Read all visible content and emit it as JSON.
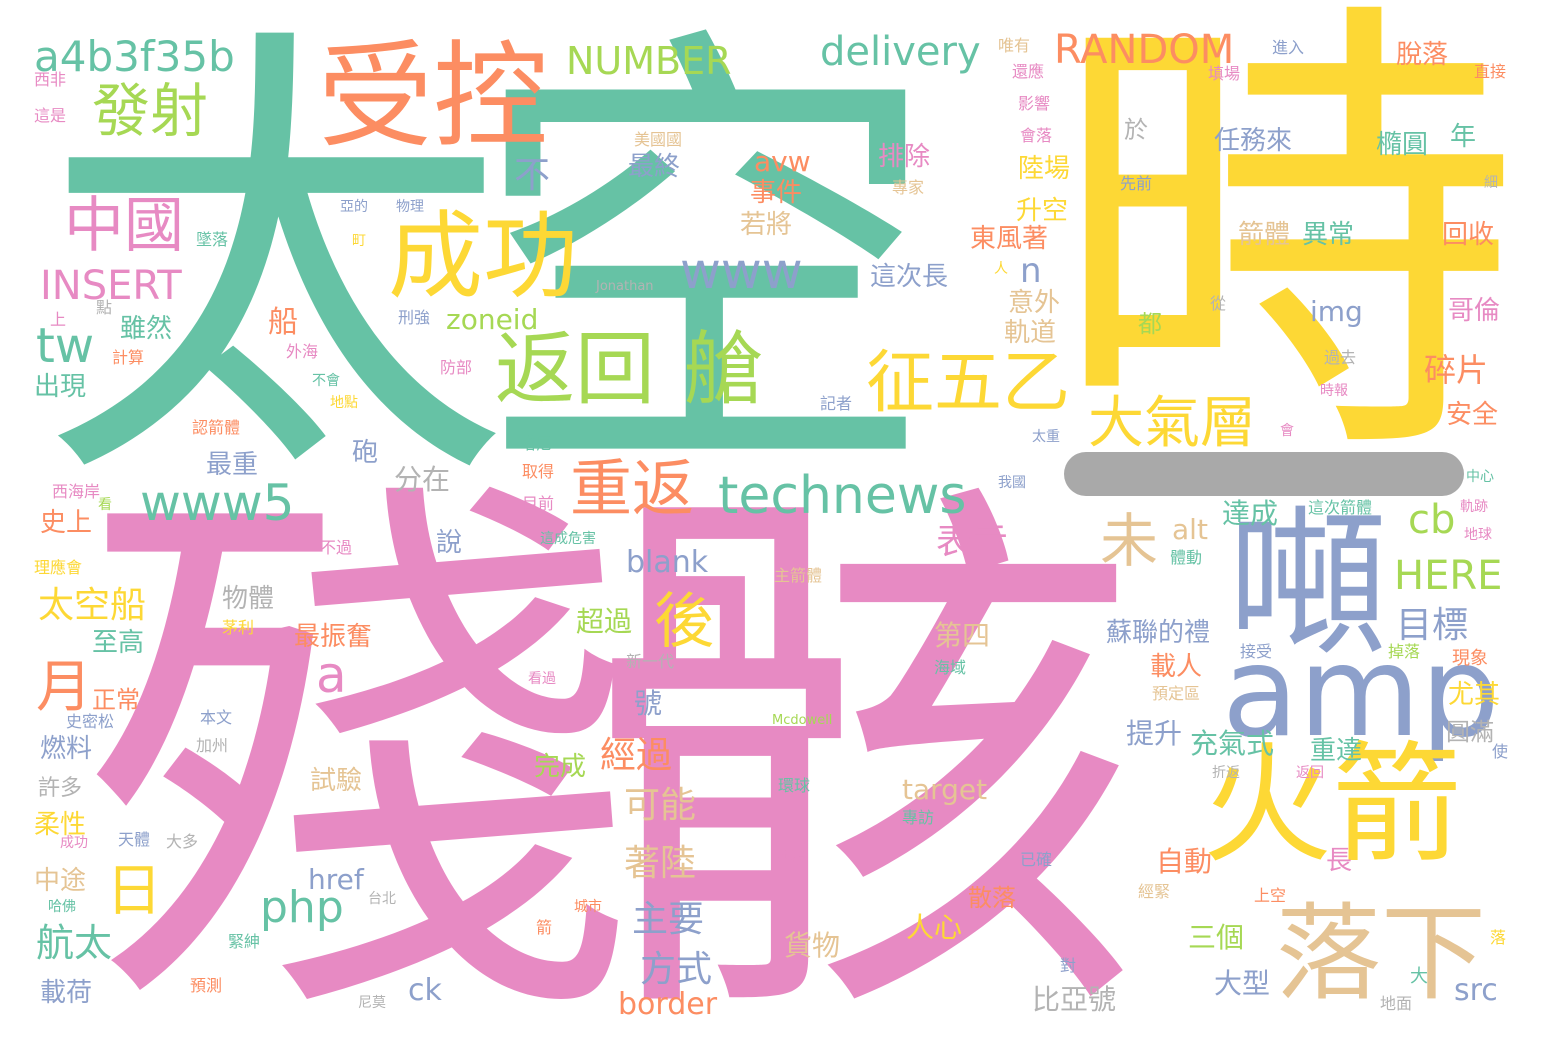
{
  "colors": {
    "green": "#66c2a5",
    "yellow": "#fdd835",
    "orange": "#fc8d62",
    "pink": "#e78ac3",
    "blue": "#8da0cb",
    "lime": "#a6d854",
    "tan": "#e5c494",
    "gray": "#b3b3b3"
  },
  "words": [
    {
      "text": "太空",
      "color": "#66c2a5"
    },
    {
      "text": "時",
      "color": "#fdd835"
    },
    {
      "text": "殘骸",
      "color": "#e78ac3"
    },
    {
      "text": "受控",
      "color": "#fc8d62"
    },
    {
      "text": "成功",
      "color": "#fdd835"
    },
    {
      "text": "返回",
      "color": "#a6d854"
    },
    {
      "text": "艙",
      "color": "#a6d854"
    },
    {
      "text": "征五乙",
      "color": "#fdd835"
    },
    {
      "text": "大氣層",
      "color": "#fdd835"
    },
    {
      "text": "噸",
      "color": "#8da0cb"
    },
    {
      "text": "amp",
      "color": "#8da0cb"
    },
    {
      "text": "火箭",
      "color": "#fdd835"
    },
    {
      "text": "落下",
      "color": "#e5c494"
    },
    {
      "text": "technews",
      "color": "#66c2a5"
    },
    {
      "text": "www5",
      "color": "#66c2a5"
    },
    {
      "text": "www",
      "color": "#8da0cb"
    },
    {
      "text": "重返",
      "color": "#fc8d62"
    },
    {
      "text": "發射",
      "color": "#a6d854"
    },
    {
      "text": "中國",
      "color": "#e78ac3"
    },
    {
      "text": "a4b3f35b",
      "color": "#66c2a5"
    },
    {
      "text": "NUMBER",
      "color": "#a6d854"
    },
    {
      "text": "delivery",
      "color": "#66c2a5"
    },
    {
      "text": "RANDOM",
      "color": "#fc8d62"
    },
    {
      "text": "INSERT",
      "color": "#e78ac3"
    },
    {
      "text": "tw",
      "color": "#66c2a5"
    },
    {
      "text": "後",
      "color": "#fdd835"
    },
    {
      "text": "未",
      "color": "#e5c494"
    },
    {
      "text": "月",
      "color": "#fc8d62"
    },
    {
      "text": "日",
      "color": "#fdd835"
    },
    {
      "text": "a",
      "color": "#e78ac3"
    },
    {
      "text": "php",
      "color": "#66c2a5"
    },
    {
      "text": "cb",
      "color": "#a6d854"
    },
    {
      "text": "HERE",
      "color": "#a6d854"
    },
    {
      "text": "太空船",
      "color": "#fdd835"
    },
    {
      "text": "航太",
      "color": "#66c2a5"
    },
    {
      "text": "主要",
      "color": "#8da0cb"
    },
    {
      "text": "方式",
      "color": "#8da0cb"
    },
    {
      "text": "著陸",
      "color": "#e5c494"
    },
    {
      "text": "可能",
      "color": "#e5c494"
    },
    {
      "text": "經過",
      "color": "#fc8d62"
    },
    {
      "text": "表示",
      "color": "#e78ac3"
    },
    {
      "text": "目標",
      "color": "#8da0cb"
    },
    {
      "text": "碎片",
      "color": "#fc8d62"
    },
    {
      "text": "n",
      "color": "#8da0cb"
    },
    {
      "text": "zoneid",
      "color": "#a6d854"
    },
    {
      "text": "img",
      "color": "#8da0cb"
    },
    {
      "text": "blank",
      "color": "#8da0cb"
    },
    {
      "text": "src",
      "color": "#8da0cb"
    },
    {
      "text": "border",
      "color": "#fc8d62"
    },
    {
      "text": "ck",
      "color": "#8da0cb"
    },
    {
      "text": "href",
      "color": "#8da0cb"
    },
    {
      "text": "alt",
      "color": "#e5c494"
    },
    {
      "text": "target",
      "color": "#e5c494"
    },
    {
      "text": "avw",
      "color": "#fc8d62"
    },
    {
      "text": "不",
      "color": "#8da0cb"
    },
    {
      "text": "船",
      "color": "#fc8d62"
    },
    {
      "text": "雖然",
      "color": "#66c2a5"
    },
    {
      "text": "出現",
      "color": "#66c2a5"
    },
    {
      "text": "最重",
      "color": "#8da0cb"
    },
    {
      "text": "史上",
      "color": "#fc8d62"
    },
    {
      "text": "砲",
      "color": "#8da0cb"
    },
    {
      "text": "分在",
      "color": "#b3b3b3"
    },
    {
      "text": "說",
      "color": "#8da0cb"
    },
    {
      "text": "物體",
      "color": "#b3b3b3"
    },
    {
      "text": "至高",
      "color": "#66c2a5"
    },
    {
      "text": "最振奮",
      "color": "#fc8d62"
    },
    {
      "text": "號",
      "color": "#8da0cb"
    },
    {
      "text": "正常",
      "color": "#fc8d62"
    },
    {
      "text": "燃料",
      "color": "#8da0cb"
    },
    {
      "text": "完成",
      "color": "#a6d854"
    },
    {
      "text": "試驗",
      "color": "#e5c494"
    },
    {
      "text": "許多",
      "color": "#b3b3b3"
    },
    {
      "text": "柔性",
      "color": "#fdd835"
    },
    {
      "text": "中途",
      "color": "#e5c494"
    },
    {
      "text": "載荷",
      "color": "#8da0cb"
    },
    {
      "text": "貨物",
      "color": "#e5c494"
    },
    {
      "text": "超過",
      "color": "#a6d854"
    },
    {
      "text": "人心",
      "color": "#fdd835"
    },
    {
      "text": "比亞號",
      "color": "#b3b3b3"
    },
    {
      "text": "散落",
      "color": "#fc8d62"
    },
    {
      "text": "三個",
      "color": "#a6d854"
    },
    {
      "text": "大型",
      "color": "#8da0cb"
    },
    {
      "text": "自動",
      "color": "#fc8d62"
    },
    {
      "text": "長",
      "color": "#e78ac3"
    },
    {
      "text": "第四",
      "color": "#e5c494"
    },
    {
      "text": "提升",
      "color": "#8da0cb"
    },
    {
      "text": "充氣式",
      "color": "#66c2a5"
    },
    {
      "text": "重達",
      "color": "#66c2a5"
    },
    {
      "text": "載人",
      "color": "#fc8d62"
    },
    {
      "text": "蘇聯的禮",
      "color": "#8da0cb"
    },
    {
      "text": "達成",
      "color": "#66c2a5"
    },
    {
      "text": "尤其",
      "color": "#fdd835"
    },
    {
      "text": "圓滿",
      "color": "#b3b3b3"
    },
    {
      "text": "安全",
      "color": "#fc8d62"
    },
    {
      "text": "哥倫",
      "color": "#e78ac3"
    },
    {
      "text": "回收",
      "color": "#fc8d62"
    },
    {
      "text": "箭體",
      "color": "#e5c494"
    },
    {
      "text": "異常",
      "color": "#66c2a5"
    },
    {
      "text": "任務來",
      "color": "#8da0cb"
    },
    {
      "text": "橢圓",
      "color": "#66c2a5"
    },
    {
      "text": "年",
      "color": "#66c2a5"
    },
    {
      "text": "脫落",
      "color": "#fc8d62"
    },
    {
      "text": "最終",
      "color": "#8da0cb"
    },
    {
      "text": "排除",
      "color": "#e78ac3"
    },
    {
      "text": "事件",
      "color": "#fc8d62"
    },
    {
      "text": "若將",
      "color": "#e5c494"
    },
    {
      "text": "陸場",
      "color": "#fdd835"
    },
    {
      "text": "升空",
      "color": "#fdd835"
    },
    {
      "text": "東風著",
      "color": "#fc8d62"
    },
    {
      "text": "這次長",
      "color": "#8da0cb"
    },
    {
      "text": "意外",
      "color": "#e5c494"
    },
    {
      "text": "軌道",
      "color": "#e5c494"
    },
    {
      "text": "都",
      "color": "#a6d854"
    },
    {
      "text": "於",
      "color": "#b3b3b3"
    },
    {
      "text": "西非",
      "color": "#e78ac3"
    },
    {
      "text": "這是",
      "color": "#e78ac3"
    },
    {
      "text": "唯有",
      "color": "#e5c494"
    },
    {
      "text": "還應",
      "color": "#e78ac3"
    },
    {
      "text": "影響",
      "color": "#e78ac3"
    },
    {
      "text": "會落",
      "color": "#e78ac3"
    },
    {
      "text": "美國國",
      "color": "#e5c494"
    },
    {
      "text": "專家",
      "color": "#e5c494"
    },
    {
      "text": "墜落",
      "color": "#66c2a5"
    },
    {
      "text": "亞的",
      "color": "#8da0cb"
    },
    {
      "text": "物理",
      "color": "#8da0cb"
    },
    {
      "text": "町",
      "color": "#fdd835"
    },
    {
      "text": "Jonathan",
      "color": "#b3b3b3"
    },
    {
      "text": "刑強",
      "color": "#8da0cb"
    },
    {
      "text": "外海",
      "color": "#e78ac3"
    },
    {
      "text": "不會",
      "color": "#66c2a5"
    },
    {
      "text": "地點",
      "color": "#fdd835"
    },
    {
      "text": "防部",
      "color": "#e78ac3"
    },
    {
      "text": "記者",
      "color": "#8da0cb"
    },
    {
      "text": "認箭體",
      "color": "#fc8d62"
    },
    {
      "text": "塔尼",
      "color": "#66c2a5"
    },
    {
      "text": "取得",
      "color": "#fc8d62"
    },
    {
      "text": "目前",
      "color": "#e78ac3"
    },
    {
      "text": "西海岸",
      "color": "#e78ac3"
    },
    {
      "text": "理應會",
      "color": "#fdd835"
    },
    {
      "text": "不過",
      "color": "#e78ac3"
    },
    {
      "text": "這成危害",
      "color": "#66c2a5"
    },
    {
      "text": "主箭體",
      "color": "#e5c494"
    },
    {
      "text": "茅利",
      "color": "#fdd835"
    },
    {
      "text": "新一代",
      "color": "#b3b3b3"
    },
    {
      "text": "看過",
      "color": "#e78ac3"
    },
    {
      "text": "Mcdowell",
      "color": "#a6d854"
    },
    {
      "text": "本文",
      "color": "#8da0cb"
    },
    {
      "text": "加州",
      "color": "#b3b3b3"
    },
    {
      "text": "史密松",
      "color": "#8da0cb"
    },
    {
      "text": "環球",
      "color": "#66c2a5"
    },
    {
      "text": "天體",
      "color": "#8da0cb"
    },
    {
      "text": "大多",
      "color": "#b3b3b3"
    },
    {
      "text": "成功",
      "color": "#e78ac3"
    },
    {
      "text": "哈佛",
      "color": "#66c2a5"
    },
    {
      "text": "台北",
      "color": "#b3b3b3"
    },
    {
      "text": "焚毀",
      "color": "#e78ac3"
    },
    {
      "text": "城市",
      "color": "#fc8d62"
    },
    {
      "text": "緊紳",
      "color": "#66c2a5"
    },
    {
      "text": "預測",
      "color": "#fc8d62"
    },
    {
      "text": "尼莫",
      "color": "#b3b3b3"
    },
    {
      "text": "對",
      "color": "#8da0cb"
    },
    {
      "text": "箭",
      "color": "#fc8d62"
    },
    {
      "text": "已確",
      "color": "#8da0cb"
    },
    {
      "text": "經緊",
      "color": "#e5c494"
    },
    {
      "text": "上空",
      "color": "#fc8d62"
    },
    {
      "text": "地面",
      "color": "#b3b3b3"
    },
    {
      "text": "海域",
      "color": "#66c2a5"
    },
    {
      "text": "專訪",
      "color": "#66c2a5"
    },
    {
      "text": "預定區",
      "color": "#e5c494"
    },
    {
      "text": "體動",
      "color": "#66c2a5"
    },
    {
      "text": "接受",
      "color": "#8da0cb"
    },
    {
      "text": "掉落",
      "color": "#a6d854"
    },
    {
      "text": "現象",
      "color": "#fc8d62"
    },
    {
      "text": "使",
      "color": "#8da0cb"
    },
    {
      "text": "折返",
      "color": "#b3b3b3"
    },
    {
      "text": "返回",
      "color": "#e78ac3"
    },
    {
      "text": "這次箭體",
      "color": "#66c2a5"
    },
    {
      "text": "軌跡",
      "color": "#e78ac3"
    },
    {
      "text": "地球",
      "color": "#e78ac3"
    },
    {
      "text": "中心",
      "color": "#66c2a5"
    },
    {
      "text": "時報",
      "color": "#e78ac3"
    },
    {
      "text": "過去",
      "color": "#b3b3b3"
    },
    {
      "text": "會",
      "color": "#e78ac3"
    },
    {
      "text": "先前",
      "color": "#8da0cb"
    },
    {
      "text": "從",
      "color": "#b3b3b3"
    },
    {
      "text": "太重",
      "color": "#8da0cb"
    },
    {
      "text": "我國",
      "color": "#8da0cb"
    },
    {
      "text": "看",
      "color": "#a6d854"
    },
    {
      "text": "計算",
      "color": "#fc8d62"
    },
    {
      "text": "上",
      "color": "#e78ac3"
    },
    {
      "text": "點",
      "color": "#b3b3b3"
    },
    {
      "text": "人",
      "color": "#fdd835"
    },
    {
      "text": "填場",
      "color": "#e78ac3"
    },
    {
      "text": "進入",
      "color": "#8da0cb"
    },
    {
      "text": "直接",
      "color": "#fc8d62"
    },
    {
      "text": "細",
      "color": "#b3b3b3"
    },
    {
      "text": "落",
      "color": "#fdd835"
    },
    {
      "text": "大",
      "color": "#66c2a5"
    }
  ]
}
